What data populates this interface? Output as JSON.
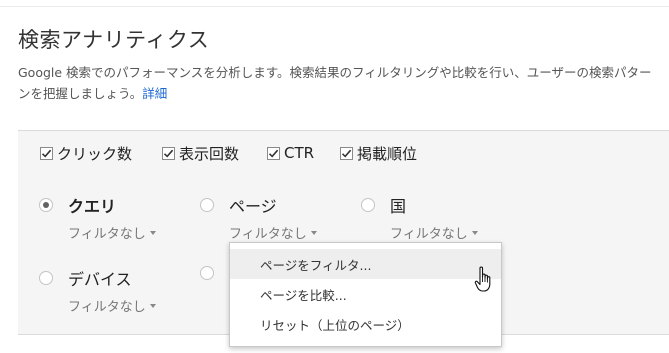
{
  "header": {
    "title": "検索アナリティクス",
    "description": "Google 検索でのパフォーマンスを分析します。検索結果のフィルタリングや比較を行い、ユーザーの検索パターンを把握しましょう。",
    "details_link": "詳細"
  },
  "metrics": [
    {
      "label": "クリック数",
      "checked": true
    },
    {
      "label": "表示回数",
      "checked": true
    },
    {
      "label": "CTR",
      "checked": true
    },
    {
      "label": "掲載順位",
      "checked": true
    }
  ],
  "dimensions": {
    "query": {
      "label": "クエリ",
      "selected": true,
      "filter": "フィルタなし"
    },
    "page": {
      "label": "ページ",
      "selected": false,
      "filter": "フィルタなし"
    },
    "country": {
      "label": "国",
      "selected": false,
      "filter": "フィルタなし"
    },
    "device": {
      "label": "デバイス",
      "selected": false,
      "filter": "フィルタなし"
    }
  },
  "page_menu": {
    "items": [
      {
        "label": "ページをフィルタ..."
      },
      {
        "label": "ページを比較..."
      },
      {
        "label": "リセット（上位のページ）"
      }
    ]
  },
  "colors": {
    "link": "#1a66d2",
    "panel": "#f5f5f5"
  }
}
